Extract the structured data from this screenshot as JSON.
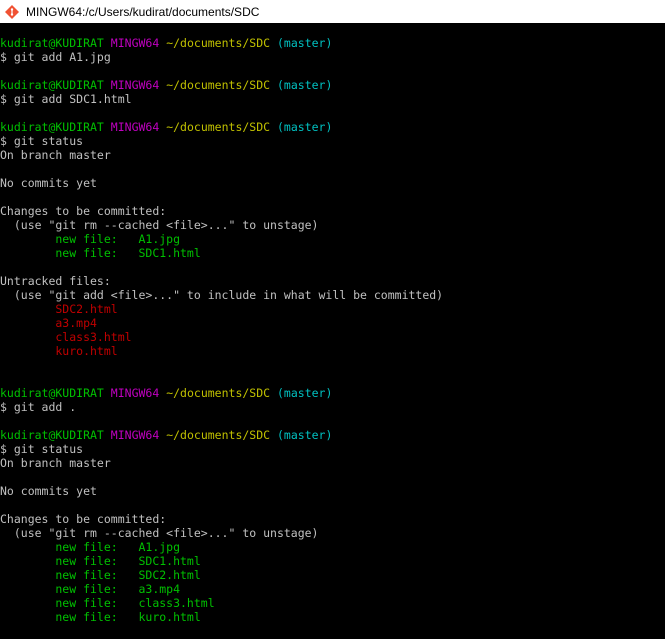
{
  "window": {
    "title": "MINGW64:/c/Users/kudirat/documents/SDC"
  },
  "terminal": {
    "lines": [
      [
        {
          "t": "kudirat@KUDIRAT",
          "c": "green"
        },
        {
          "t": " ",
          "c": "white"
        },
        {
          "t": "MINGW64",
          "c": "purple"
        },
        {
          "t": " ",
          "c": "white"
        },
        {
          "t": "~/documents/SDC",
          "c": "yellow"
        },
        {
          "t": " ",
          "c": "white"
        },
        {
          "t": "(master)",
          "c": "cyan"
        }
      ],
      [
        {
          "t": "$ git add A1.jpg",
          "c": "white"
        }
      ],
      [],
      [
        {
          "t": "kudirat@KUDIRAT",
          "c": "green"
        },
        {
          "t": " ",
          "c": "white"
        },
        {
          "t": "MINGW64",
          "c": "purple"
        },
        {
          "t": " ",
          "c": "white"
        },
        {
          "t": "~/documents/SDC",
          "c": "yellow"
        },
        {
          "t": " ",
          "c": "white"
        },
        {
          "t": "(master)",
          "c": "cyan"
        }
      ],
      [
        {
          "t": "$ git add SDC1.html",
          "c": "white"
        }
      ],
      [],
      [
        {
          "t": "kudirat@KUDIRAT",
          "c": "green"
        },
        {
          "t": " ",
          "c": "white"
        },
        {
          "t": "MINGW64",
          "c": "purple"
        },
        {
          "t": " ",
          "c": "white"
        },
        {
          "t": "~/documents/SDC",
          "c": "yellow"
        },
        {
          "t": " ",
          "c": "white"
        },
        {
          "t": "(master)",
          "c": "cyan"
        }
      ],
      [
        {
          "t": "$ git status",
          "c": "white"
        }
      ],
      [
        {
          "t": "On branch master",
          "c": "white"
        }
      ],
      [],
      [
        {
          "t": "No commits yet",
          "c": "white"
        }
      ],
      [],
      [
        {
          "t": "Changes to be committed:",
          "c": "white"
        }
      ],
      [
        {
          "t": "  (use \"git rm --cached <file>...\" to unstage)",
          "c": "white"
        }
      ],
      [
        {
          "t": "        new file:   A1.jpg",
          "c": "green"
        }
      ],
      [
        {
          "t": "        new file:   SDC1.html",
          "c": "green"
        }
      ],
      [],
      [
        {
          "t": "Untracked files:",
          "c": "white"
        }
      ],
      [
        {
          "t": "  (use \"git add <file>...\" to include in what will be committed)",
          "c": "white"
        }
      ],
      [
        {
          "t": "        SDC2.html",
          "c": "red"
        }
      ],
      [
        {
          "t": "        a3.mp4",
          "c": "red"
        }
      ],
      [
        {
          "t": "        class3.html",
          "c": "red"
        }
      ],
      [
        {
          "t": "        kuro.html",
          "c": "red"
        }
      ],
      [],
      [],
      [
        {
          "t": "kudirat@KUDIRAT",
          "c": "green"
        },
        {
          "t": " ",
          "c": "white"
        },
        {
          "t": "MINGW64",
          "c": "purple"
        },
        {
          "t": " ",
          "c": "white"
        },
        {
          "t": "~/documents/SDC",
          "c": "yellow"
        },
        {
          "t": " ",
          "c": "white"
        },
        {
          "t": "(master)",
          "c": "cyan"
        }
      ],
      [
        {
          "t": "$ git add .",
          "c": "white"
        }
      ],
      [],
      [
        {
          "t": "kudirat@KUDIRAT",
          "c": "green"
        },
        {
          "t": " ",
          "c": "white"
        },
        {
          "t": "MINGW64",
          "c": "purple"
        },
        {
          "t": " ",
          "c": "white"
        },
        {
          "t": "~/documents/SDC",
          "c": "yellow"
        },
        {
          "t": " ",
          "c": "white"
        },
        {
          "t": "(master)",
          "c": "cyan"
        }
      ],
      [
        {
          "t": "$ git status",
          "c": "white"
        }
      ],
      [
        {
          "t": "On branch master",
          "c": "white"
        }
      ],
      [],
      [
        {
          "t": "No commits yet",
          "c": "white"
        }
      ],
      [],
      [
        {
          "t": "Changes to be committed:",
          "c": "white"
        }
      ],
      [
        {
          "t": "  (use \"git rm --cached <file>...\" to unstage)",
          "c": "white"
        }
      ],
      [
        {
          "t": "        new file:   A1.jpg",
          "c": "green"
        }
      ],
      [
        {
          "t": "        new file:   SDC1.html",
          "c": "green"
        }
      ],
      [
        {
          "t": "        new file:   SDC2.html",
          "c": "green"
        }
      ],
      [
        {
          "t": "        new file:   a3.mp4",
          "c": "green"
        }
      ],
      [
        {
          "t": "        new file:   class3.html",
          "c": "green"
        }
      ],
      [
        {
          "t": "        new file:   kuro.html",
          "c": "green"
        }
      ]
    ]
  },
  "colors": {
    "background": "#000000",
    "green": "#00c000",
    "purple": "#c000c0",
    "yellow": "#c0c000",
    "cyan": "#00c0c0",
    "red": "#c00000",
    "text": "#c0c0c0"
  },
  "icons": {
    "app": "git-bash-icon"
  }
}
